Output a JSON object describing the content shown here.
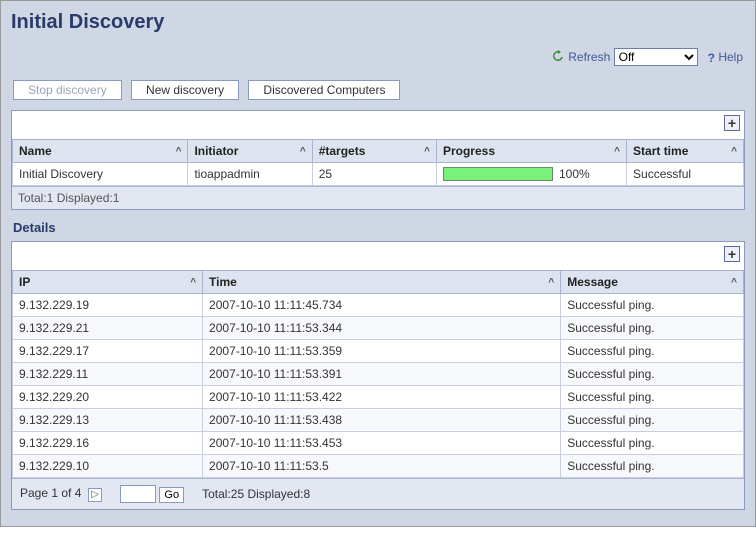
{
  "title": "Initial Discovery",
  "top": {
    "refresh_label": "Refresh",
    "refresh_select": "Off",
    "help_label": "Help"
  },
  "toolbar": {
    "stop": "Stop discovery",
    "new": "New discovery",
    "discovered": "Discovered Computers"
  },
  "summary": {
    "cols": {
      "name": "Name",
      "initiator": "Initiator",
      "targets": "#targets",
      "progress": "Progress",
      "start": "Start time"
    },
    "rows": [
      {
        "name": "Initial Discovery",
        "initiator": "tioappadmin",
        "targets": "25",
        "progress_pct": 100,
        "progress_label": "100%",
        "start": "Successful"
      }
    ],
    "status": "Total:1 Displayed:1"
  },
  "details": {
    "heading": "Details",
    "cols": {
      "ip": "IP",
      "time": "Time",
      "message": "Message"
    },
    "rows": [
      {
        "ip": "9.132.229.19",
        "time": "2007-10-10 11:11:45.734",
        "message": "Successful ping."
      },
      {
        "ip": "9.132.229.21",
        "time": "2007-10-10 11:11:53.344",
        "message": "Successful ping."
      },
      {
        "ip": "9.132.229.17",
        "time": "2007-10-10 11:11:53.359",
        "message": "Successful ping."
      },
      {
        "ip": "9.132.229.11",
        "time": "2007-10-10 11:11:53.391",
        "message": "Successful ping."
      },
      {
        "ip": "9.132.229.20",
        "time": "2007-10-10 11:11:53.422",
        "message": "Successful ping."
      },
      {
        "ip": "9.132.229.13",
        "time": "2007-10-10 11:11:53.438",
        "message": "Successful ping."
      },
      {
        "ip": "9.132.229.16",
        "time": "2007-10-10 11:11:53.453",
        "message": "Successful ping."
      },
      {
        "ip": "9.132.229.10",
        "time": "2007-10-10 11:11:53.5",
        "message": "Successful ping."
      }
    ],
    "pager": {
      "label": "Page 1 of 4",
      "go": "Go",
      "status": "Total:25 Displayed:8"
    }
  }
}
